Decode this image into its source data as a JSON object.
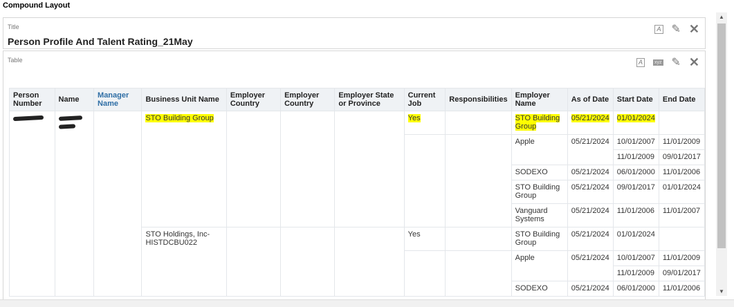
{
  "page_title": "Compound Layout",
  "title_view": {
    "label": "Title",
    "title": "Person Profile And Talent Rating_21May"
  },
  "table_view": {
    "label": "Table"
  },
  "icons": {
    "format": "A",
    "xyz": "xyz"
  },
  "headers": [
    "Person Number",
    "Name",
    "Manager Name",
    "Business Unit Name",
    "Employer Country",
    "Employer Country",
    "Employer State or Province",
    "Current Job",
    "Responsibilities",
    "Employer Name",
    "As of Date",
    "Start Date",
    "End Date"
  ],
  "groups": [
    {
      "bu": "STO Building Group",
      "current": "Yes",
      "rows": [
        {
          "employer": "STO Building Group",
          "asof": "05/21/2024",
          "start": "01/01/2024",
          "end": ""
        },
        {
          "employer": "Apple",
          "asof": "05/21/2024",
          "start": "10/01/2007",
          "end": "11/01/2009"
        },
        {
          "start": "11/01/2009",
          "end": "09/01/2017"
        },
        {
          "employer": "SODEXO",
          "asof": "05/21/2024",
          "start": "06/01/2000",
          "end": "11/01/2006"
        },
        {
          "employer": "STO Building Group",
          "asof": "05/21/2024",
          "start": "09/01/2017",
          "end": "01/01/2024"
        },
        {
          "employer": "Vanguard Systems",
          "asof": "05/21/2024",
          "start": "11/01/2006",
          "end": "11/01/2007"
        }
      ]
    },
    {
      "bu": "STO Holdings, Inc-HISTDCBU022",
      "current": "Yes",
      "rows": [
        {
          "employer": "STO Building Group",
          "asof": "05/21/2024",
          "start": "01/01/2024",
          "end": ""
        },
        {
          "employer": "Apple",
          "asof": "05/21/2024",
          "start": "10/01/2007",
          "end": "11/01/2009"
        },
        {
          "start": "11/01/2009",
          "end": "09/01/2017"
        },
        {
          "employer": "SODEXO",
          "asof": "05/21/2024",
          "start": "06/01/2000",
          "end": "11/01/2006"
        }
      ]
    }
  ],
  "highlight_color": "#ffff00"
}
